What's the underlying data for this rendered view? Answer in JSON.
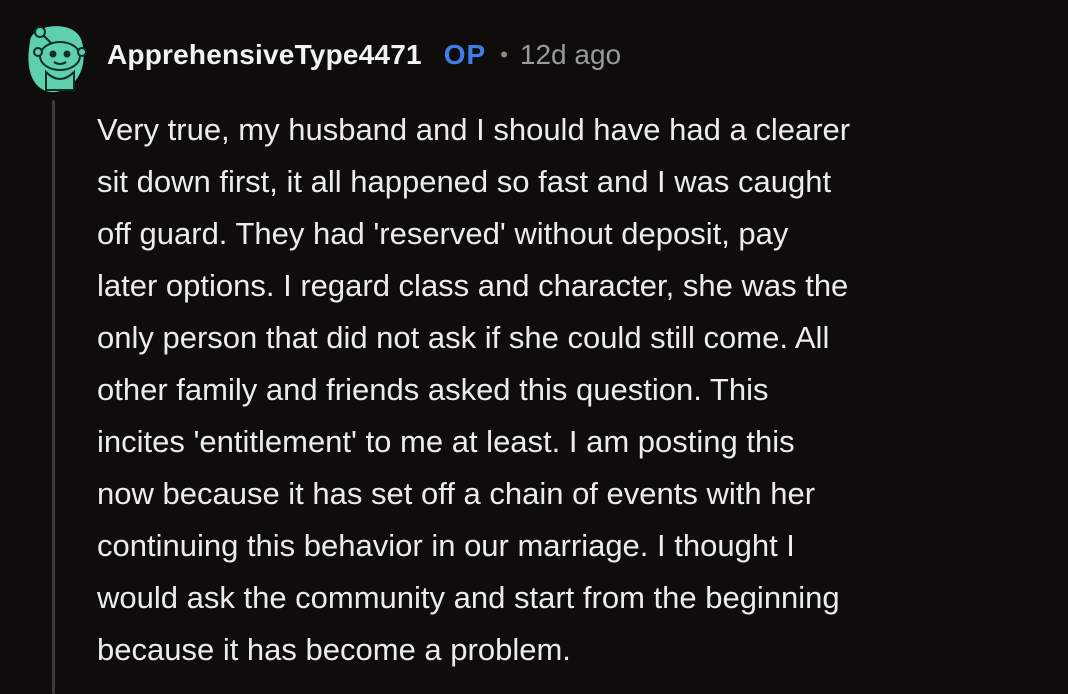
{
  "comment": {
    "author": "ApprehensiveType4471",
    "badge": "OP",
    "separator": "•",
    "timestamp": "12d ago",
    "body_lines": [
      "Very true, my husband and I should have had a clearer",
      "sit down first, it all happened so fast and I was caught",
      "off guard. They had 'reserved' without deposit, pay",
      "later options. I regard class and character, she was the",
      "only person that did not ask if she could still come. All",
      "other family and friends asked this question. This",
      "incites 'entitlement' to me at least. I am posting this",
      "now because it has set off a chain of events with her",
      "continuing this behavior in our marriage. I thought I",
      "would ask the community and start from the beginning",
      "because it has become a problem."
    ]
  },
  "colors": {
    "background": "#0f0d0c",
    "avatar": "#5fd0ae",
    "op_badge": "#3e7ee8",
    "text": "#ececec",
    "muted": "#9a9a9a",
    "thread_line": "#3a3a3a"
  },
  "icons": {
    "avatar": "snoo-avatar-icon"
  }
}
